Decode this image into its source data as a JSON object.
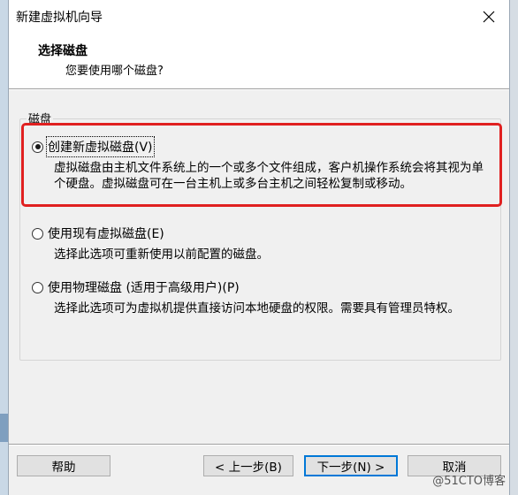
{
  "window": {
    "title": "新建虚拟机向导"
  },
  "header": {
    "title": "选择磁盘",
    "subtitle": "您要使用哪个磁盘?"
  },
  "group": {
    "label": "磁盘"
  },
  "options": [
    {
      "label": "创建新虚拟磁盘(V)",
      "description": "虚拟磁盘由主机文件系统上的一个或多个文件组成，客户机操作系统会将其视为单个硬盘。虚拟磁盘可在一台主机上或多台主机之间轻松复制或移动。",
      "checked": true
    },
    {
      "label": "使用现有虚拟磁盘(E)",
      "description": "选择此选项可重新使用以前配置的磁盘。",
      "checked": false
    },
    {
      "label": "使用物理磁盘 (适用于高级用户)(P)",
      "description": "选择此选项可为虚拟机提供直接访问本地硬盘的权限。需要具有管理员特权。",
      "checked": false
    }
  ],
  "buttons": {
    "help": "帮助",
    "back": "< 上一步(B)",
    "next": "下一步(N) >",
    "cancel": "取消"
  },
  "watermark": "@51CTO博客",
  "colors": {
    "highlight": "#e02020",
    "default_button_border": "#0078d7"
  },
  "icons": {
    "close": "close-icon"
  }
}
